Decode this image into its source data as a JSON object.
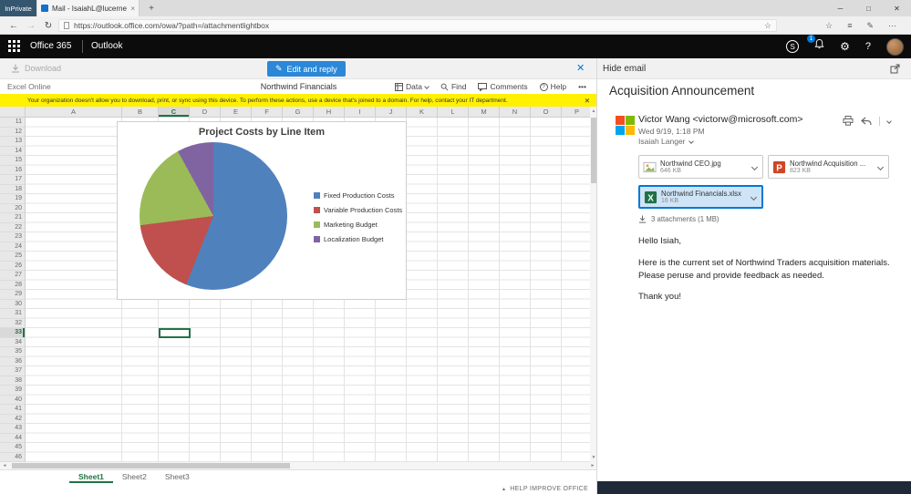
{
  "browser": {
    "inprivate_label": "InPrivate",
    "tab_title": "Mail - IsaiahL@lucerne",
    "url": "https://outlook.office.com/owa/?path=/attachmentlightbox"
  },
  "icons": {
    "back": "←",
    "forward": "→",
    "refresh": "↻",
    "star": "☆",
    "hub": "≡",
    "note": "✎",
    "more": "···",
    "minimize": "─",
    "maximize": "□",
    "close": "✕",
    "newtab": "+",
    "tab_close": "×",
    "skype_s": "S",
    "gear": "⚙",
    "question": "?",
    "pencil": "✎",
    "blue_close": "✕",
    "warn_close": "✕",
    "up": "▲",
    "down": "▼",
    "left": "◄",
    "right": "►",
    "tri_up": "▴",
    "menu_more": "•••"
  },
  "office_header": {
    "brand": "Office 365",
    "app": "Outlook",
    "notification_count": "1"
  },
  "preview_toolbar": {
    "download_label": "Download",
    "edit_reply_label": "Edit and reply"
  },
  "excel_toolbar": {
    "app_label": "Excel Online",
    "doc_title": "Northwind Financials",
    "menu_data": "Data",
    "menu_find": "Find",
    "menu_comments": "Comments",
    "menu_help": "Help"
  },
  "warning_bar": {
    "text": "Your organization doesn't allow you to download, print, or sync using this device. To perform these actions, use a device that's joined to a domain. For help, contact your IT department."
  },
  "spreadsheet": {
    "columns": [
      "A",
      "B",
      "C",
      "D",
      "E",
      "F",
      "G",
      "H",
      "I",
      "J",
      "K",
      "L",
      "M",
      "N",
      "O",
      "P"
    ],
    "rows": [
      11,
      12,
      13,
      14,
      15,
      16,
      17,
      18,
      19,
      20,
      21,
      22,
      23,
      24,
      25,
      26,
      27,
      28,
      29,
      30,
      31,
      32,
      33,
      34,
      35,
      36,
      37,
      38,
      39,
      40,
      41,
      42,
      43,
      44,
      45,
      46
    ],
    "active_cell": "C33",
    "active_column": "C",
    "active_row": 33,
    "sheets": [
      {
        "label": "Sheet1",
        "active": true
      },
      {
        "label": "Sheet2",
        "active": false
      },
      {
        "label": "Sheet3",
        "active": false
      }
    ]
  },
  "chart_data": {
    "type": "pie",
    "title": "Project Costs by Line Item",
    "legend_position": "right",
    "slices": [
      {
        "label": "Fixed Production Costs",
        "value": 56,
        "color": "#4f81bd"
      },
      {
        "label": "Variable Production Costs",
        "value": 17,
        "color": "#c0504d"
      },
      {
        "label": "Marketing Budget",
        "value": 19,
        "color": "#9bbb59"
      },
      {
        "label": "Localization Budget",
        "value": 8,
        "color": "#8064a2"
      }
    ]
  },
  "email": {
    "hide_label": "Hide email",
    "subject": "Acquisition Announcement",
    "sender_name": "Victor Wang",
    "sender_email": "<victorw@microsoft.com>",
    "timestamp": "Wed 9/19, 1:18 PM",
    "recipient": "Isaiah Langer",
    "attachments_summary": "3 attachments (1 MB)",
    "attachments": [
      {
        "name": "Northwind CEO.jpg",
        "size": "646 KB",
        "kind": "image",
        "selected": false
      },
      {
        "name": "Northwind Acquisition ...",
        "size": "823 KB",
        "kind": "powerpoint",
        "selected": false
      },
      {
        "name": "Northwind Financials.xlsx",
        "size": "16 KB",
        "kind": "excel",
        "selected": true
      }
    ],
    "body": [
      "Hello Isiah,",
      "Here is the current set of Northwind Traders acquisition materials. Please peruse and provide feedback as needed.",
      "Thank you!"
    ],
    "avatar_colors": [
      "#f25022",
      "#7fba00",
      "#00a4ef",
      "#ffb900"
    ]
  },
  "footer": {
    "help_label": "HELP IMPROVE OFFICE"
  }
}
